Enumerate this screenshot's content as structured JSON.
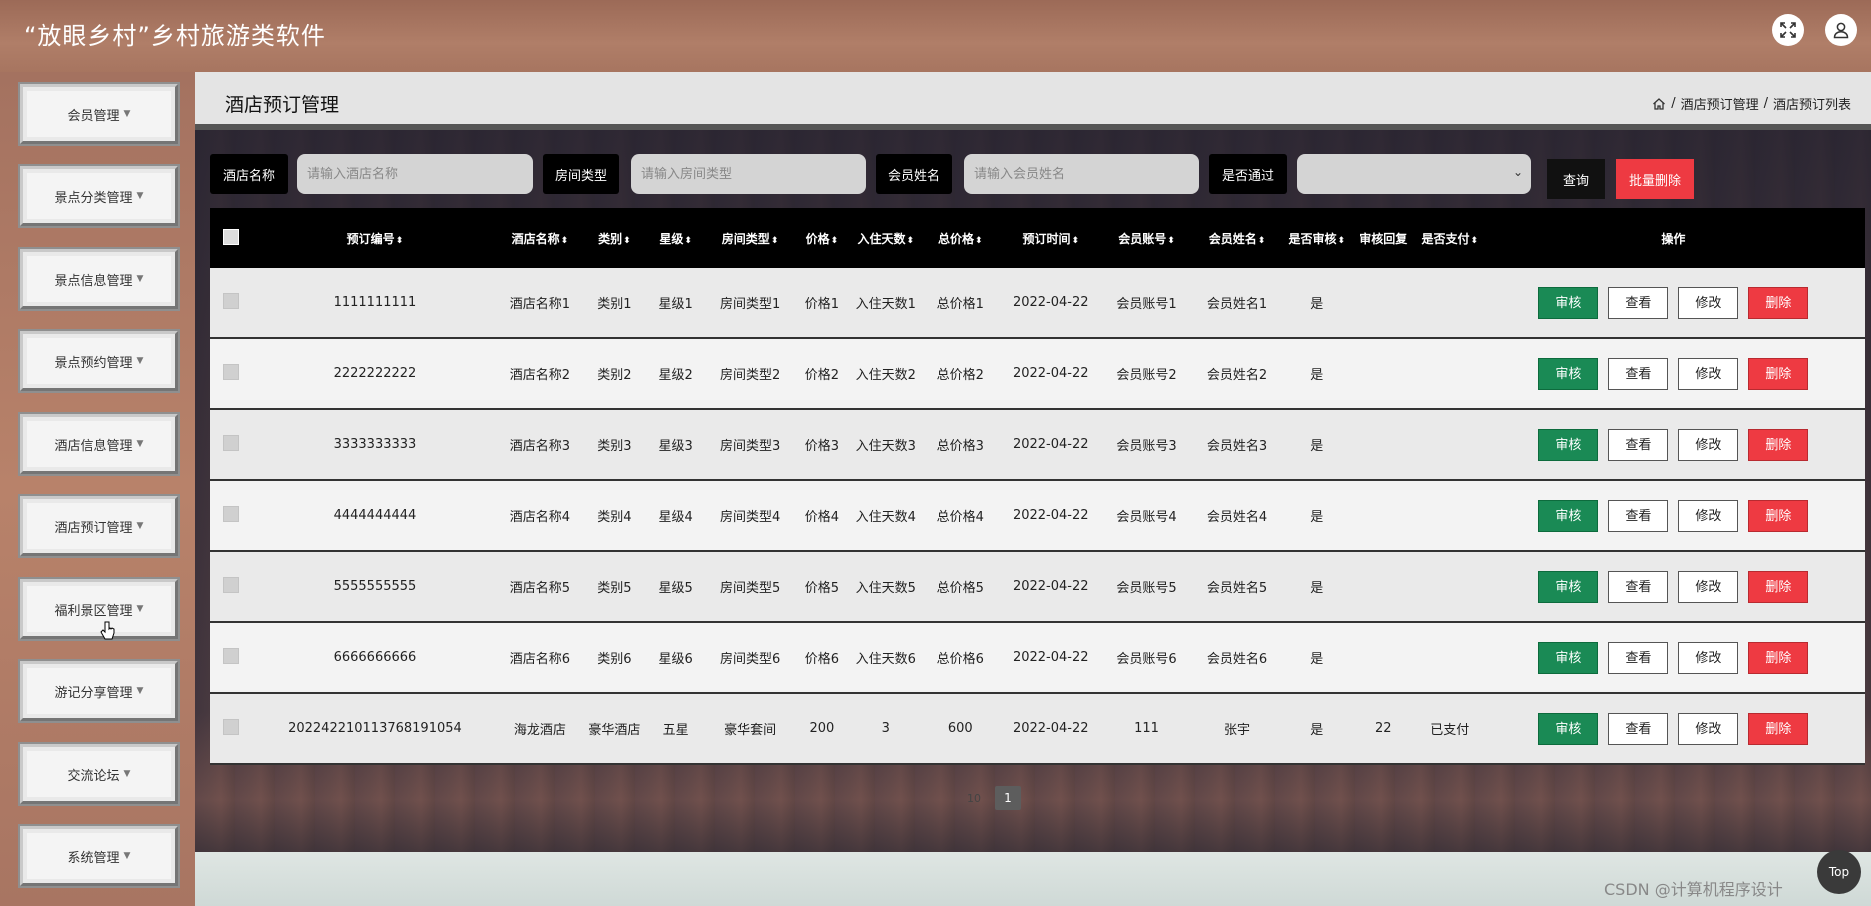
{
  "app": {
    "title": "“放眼乡村”乡村旅游类软件"
  },
  "header_icons": {
    "fullscreen": "expand-icon",
    "user": "user-icon"
  },
  "sidebar": {
    "items": [
      {
        "label": "会员管理"
      },
      {
        "label": "景点分类管理"
      },
      {
        "label": "景点信息管理"
      },
      {
        "label": "景点预约管理"
      },
      {
        "label": "酒店信息管理"
      },
      {
        "label": "酒店预订管理"
      },
      {
        "label": "福利景区管理"
      },
      {
        "label": "游记分享管理"
      },
      {
        "label": "交流论坛"
      },
      {
        "label": "系统管理"
      }
    ]
  },
  "page": {
    "title": "酒店预订管理",
    "breadcrumb": [
      "酒店预订管理",
      "酒店预订列表"
    ],
    "breadcrumb_sep": "/"
  },
  "filters": {
    "hotel_name_label": "酒店名称",
    "hotel_name_placeholder": "请输入酒店名称",
    "room_type_label": "房间类型",
    "room_type_placeholder": "请输入房间类型",
    "member_name_label": "会员姓名",
    "member_name_placeholder": "请输入会员姓名",
    "passed_label": "是否通过",
    "passed_value": "",
    "query_label": "查询",
    "batch_delete_label": "批量删除"
  },
  "table": {
    "columns": [
      "预订编号",
      "酒店名称",
      "类别",
      "星级",
      "房间类型",
      "价格",
      "入住天数",
      "总价格",
      "预订时间",
      "会员账号",
      "会员姓名",
      "是否审核",
      "审核回复",
      "是否支付",
      "操作"
    ],
    "actions": {
      "audit": "审核",
      "view": "查看",
      "edit": "修改",
      "delete": "删除"
    },
    "rows": [
      [
        "1111111111",
        "酒店名称1",
        "类别1",
        "星级1",
        "房间类型1",
        "价格1",
        "入住天数1",
        "总价格1",
        "2022-04-22",
        "会员账号1",
        "会员姓名1",
        "是",
        "",
        ""
      ],
      [
        "2222222222",
        "酒店名称2",
        "类别2",
        "星级2",
        "房间类型2",
        "价格2",
        "入住天数2",
        "总价格2",
        "2022-04-22",
        "会员账号2",
        "会员姓名2",
        "是",
        "",
        ""
      ],
      [
        "3333333333",
        "酒店名称3",
        "类别3",
        "星级3",
        "房间类型3",
        "价格3",
        "入住天数3",
        "总价格3",
        "2022-04-22",
        "会员账号3",
        "会员姓名3",
        "是",
        "",
        ""
      ],
      [
        "4444444444",
        "酒店名称4",
        "类别4",
        "星级4",
        "房间类型4",
        "价格4",
        "入住天数4",
        "总价格4",
        "2022-04-22",
        "会员账号4",
        "会员姓名4",
        "是",
        "",
        ""
      ],
      [
        "5555555555",
        "酒店名称5",
        "类别5",
        "星级5",
        "房间类型5",
        "价格5",
        "入住天数5",
        "总价格5",
        "2022-04-22",
        "会员账号5",
        "会员姓名5",
        "是",
        "",
        ""
      ],
      [
        "6666666666",
        "酒店名称6",
        "类别6",
        "星级6",
        "房间类型6",
        "价格6",
        "入住天数6",
        "总价格6",
        "2022-04-22",
        "会员账号6",
        "会员姓名6",
        "是",
        "",
        ""
      ],
      [
        "20224221011376819105​4",
        "海龙酒店",
        "豪华酒店",
        "五星",
        "豪华套间",
        "200",
        "3",
        "600",
        "2022-04-22",
        "111",
        "张宇",
        "是",
        "22",
        "已支付"
      ]
    ]
  },
  "pagination": {
    "page_size": "10",
    "current_page": "1"
  },
  "footer": {
    "watermark": "CSDN @计算机程序设计",
    "top_button": "Top"
  },
  "colors": {
    "audit": "#1a8a55",
    "delete": "#ee3a42",
    "header": "#000000"
  }
}
